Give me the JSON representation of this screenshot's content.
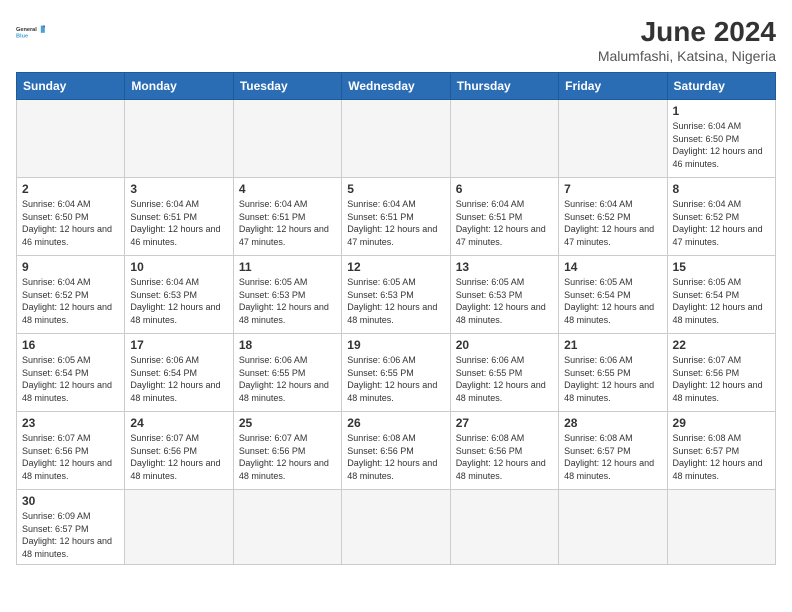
{
  "logo": {
    "text_general": "General",
    "text_blue": "Blue"
  },
  "title": {
    "month_year": "June 2024",
    "location": "Malumfashi, Katsina, Nigeria"
  },
  "weekdays": [
    "Sunday",
    "Monday",
    "Tuesday",
    "Wednesday",
    "Thursday",
    "Friday",
    "Saturday"
  ],
  "weeks": [
    [
      {
        "day": "",
        "info": ""
      },
      {
        "day": "",
        "info": ""
      },
      {
        "day": "",
        "info": ""
      },
      {
        "day": "",
        "info": ""
      },
      {
        "day": "",
        "info": ""
      },
      {
        "day": "",
        "info": ""
      },
      {
        "day": "1",
        "info": "Sunrise: 6:04 AM\nSunset: 6:50 PM\nDaylight: 12 hours and 46 minutes."
      }
    ],
    [
      {
        "day": "2",
        "info": "Sunrise: 6:04 AM\nSunset: 6:50 PM\nDaylight: 12 hours and 46 minutes."
      },
      {
        "day": "3",
        "info": "Sunrise: 6:04 AM\nSunset: 6:51 PM\nDaylight: 12 hours and 46 minutes."
      },
      {
        "day": "4",
        "info": "Sunrise: 6:04 AM\nSunset: 6:51 PM\nDaylight: 12 hours and 47 minutes."
      },
      {
        "day": "5",
        "info": "Sunrise: 6:04 AM\nSunset: 6:51 PM\nDaylight: 12 hours and 47 minutes."
      },
      {
        "day": "6",
        "info": "Sunrise: 6:04 AM\nSunset: 6:51 PM\nDaylight: 12 hours and 47 minutes."
      },
      {
        "day": "7",
        "info": "Sunrise: 6:04 AM\nSunset: 6:52 PM\nDaylight: 12 hours and 47 minutes."
      },
      {
        "day": "8",
        "info": "Sunrise: 6:04 AM\nSunset: 6:52 PM\nDaylight: 12 hours and 47 minutes."
      }
    ],
    [
      {
        "day": "9",
        "info": "Sunrise: 6:04 AM\nSunset: 6:52 PM\nDaylight: 12 hours and 48 minutes."
      },
      {
        "day": "10",
        "info": "Sunrise: 6:04 AM\nSunset: 6:53 PM\nDaylight: 12 hours and 48 minutes."
      },
      {
        "day": "11",
        "info": "Sunrise: 6:05 AM\nSunset: 6:53 PM\nDaylight: 12 hours and 48 minutes."
      },
      {
        "day": "12",
        "info": "Sunrise: 6:05 AM\nSunset: 6:53 PM\nDaylight: 12 hours and 48 minutes."
      },
      {
        "day": "13",
        "info": "Sunrise: 6:05 AM\nSunset: 6:53 PM\nDaylight: 12 hours and 48 minutes."
      },
      {
        "day": "14",
        "info": "Sunrise: 6:05 AM\nSunset: 6:54 PM\nDaylight: 12 hours and 48 minutes."
      },
      {
        "day": "15",
        "info": "Sunrise: 6:05 AM\nSunset: 6:54 PM\nDaylight: 12 hours and 48 minutes."
      }
    ],
    [
      {
        "day": "16",
        "info": "Sunrise: 6:05 AM\nSunset: 6:54 PM\nDaylight: 12 hours and 48 minutes."
      },
      {
        "day": "17",
        "info": "Sunrise: 6:06 AM\nSunset: 6:54 PM\nDaylight: 12 hours and 48 minutes."
      },
      {
        "day": "18",
        "info": "Sunrise: 6:06 AM\nSunset: 6:55 PM\nDaylight: 12 hours and 48 minutes."
      },
      {
        "day": "19",
        "info": "Sunrise: 6:06 AM\nSunset: 6:55 PM\nDaylight: 12 hours and 48 minutes."
      },
      {
        "day": "20",
        "info": "Sunrise: 6:06 AM\nSunset: 6:55 PM\nDaylight: 12 hours and 48 minutes."
      },
      {
        "day": "21",
        "info": "Sunrise: 6:06 AM\nSunset: 6:55 PM\nDaylight: 12 hours and 48 minutes."
      },
      {
        "day": "22",
        "info": "Sunrise: 6:07 AM\nSunset: 6:56 PM\nDaylight: 12 hours and 48 minutes."
      }
    ],
    [
      {
        "day": "23",
        "info": "Sunrise: 6:07 AM\nSunset: 6:56 PM\nDaylight: 12 hours and 48 minutes."
      },
      {
        "day": "24",
        "info": "Sunrise: 6:07 AM\nSunset: 6:56 PM\nDaylight: 12 hours and 48 minutes."
      },
      {
        "day": "25",
        "info": "Sunrise: 6:07 AM\nSunset: 6:56 PM\nDaylight: 12 hours and 48 minutes."
      },
      {
        "day": "26",
        "info": "Sunrise: 6:08 AM\nSunset: 6:56 PM\nDaylight: 12 hours and 48 minutes."
      },
      {
        "day": "27",
        "info": "Sunrise: 6:08 AM\nSunset: 6:56 PM\nDaylight: 12 hours and 48 minutes."
      },
      {
        "day": "28",
        "info": "Sunrise: 6:08 AM\nSunset: 6:57 PM\nDaylight: 12 hours and 48 minutes."
      },
      {
        "day": "29",
        "info": "Sunrise: 6:08 AM\nSunset: 6:57 PM\nDaylight: 12 hours and 48 minutes."
      }
    ],
    [
      {
        "day": "30",
        "info": "Sunrise: 6:09 AM\nSunset: 6:57 PM\nDaylight: 12 hours and 48 minutes."
      },
      {
        "day": "",
        "info": ""
      },
      {
        "day": "",
        "info": ""
      },
      {
        "day": "",
        "info": ""
      },
      {
        "day": "",
        "info": ""
      },
      {
        "day": "",
        "info": ""
      },
      {
        "day": "",
        "info": ""
      }
    ]
  ]
}
